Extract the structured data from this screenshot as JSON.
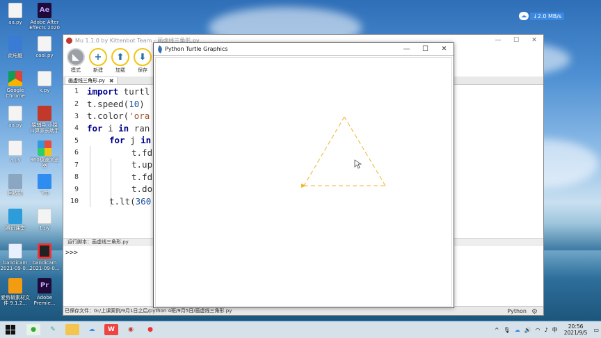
{
  "netspeed": {
    "value": "↓2.0 MB/s"
  },
  "desktop": {
    "icons": [
      {
        "label": "aa.py",
        "icon": "python-file-icon"
      },
      {
        "label": "Adobe After Effects 2020",
        "icon": "after-effects-icon"
      },
      {
        "label": "此电脑",
        "icon": "this-pc-icon"
      },
      {
        "label": "cool.py",
        "icon": "python-file-icon"
      },
      {
        "label": "Google Chrome",
        "icon": "chrome-icon"
      },
      {
        "label": "k.py",
        "icon": "python-file-icon"
      },
      {
        "label": "aa.py",
        "icon": "python-file-icon"
      },
      {
        "label": "猿辅导 小猿口算家长助手",
        "icon": "app-icon"
      },
      {
        "label": "a.py",
        "icon": "python-file-icon"
      },
      {
        "label": "360极速浏览器",
        "icon": "360-browser-icon"
      },
      {
        "label": "回收站",
        "icon": "recycle-bin-icon"
      },
      {
        "label": "飞书",
        "icon": "feishu-icon"
      },
      {
        "label": "腾讯课堂",
        "icon": "tencent-class-icon"
      },
      {
        "label": "1.py",
        "icon": "python-file-icon"
      },
      {
        "label": "bandicam 2021-09-0...",
        "icon": "document-icon"
      },
      {
        "label": "bandicam 2021-09-0...",
        "icon": "bandicam-icon"
      },
      {
        "label": "爱剪辑素材文件 9.1.2...",
        "icon": "editor-icon"
      },
      {
        "label": "Adobe Premie...",
        "icon": "premiere-icon"
      }
    ]
  },
  "mu": {
    "title": "Mu 1.1.0 by Kittenbot Team - 画虚线三角形.py",
    "controls": {
      "minimize": "—",
      "maximize": "☐",
      "close": "✕"
    },
    "toolbar": {
      "mode": "模式",
      "new": "新建",
      "load": "加载",
      "save": "保存"
    },
    "tab": {
      "label": "画虚线三角形.py",
      "close": "✖"
    },
    "line_numbers": [
      "1",
      "2",
      "3",
      "4",
      "5",
      "6",
      "7",
      "8",
      "9",
      "10"
    ],
    "code": {
      "l1_kw": "import",
      "l1_rest": " turtl",
      "l2_a": "t.speed(",
      "l2_num": "10",
      "l2_b": ")",
      "l3_a": "t.color(",
      "l3_str": "'ora",
      "l4_kw1": "for",
      "l4_mid": " i ",
      "l4_kw2": "in",
      "l4_rest": " ran",
      "l5_kw1": "for",
      "l5_mid": " j ",
      "l5_kw2": "in",
      "l6": "t.fd",
      "l7": "t.up",
      "l8": "t.fd",
      "l9": "t.do",
      "l10_a": "t.lt(",
      "l10_num": "360"
    },
    "run_bar": "运行脚本：画虚线三角形.py",
    "repl_prompt": ">>>",
    "status": "已保存文件：G:/上课案例/9月1日之后/python 4班/9月5日/画虚线三角形.py",
    "mode_label": "Python"
  },
  "turtle": {
    "title": "Python Turtle Graphics",
    "controls": {
      "minimize": "—",
      "maximize": "☐",
      "close": "✕"
    },
    "pen_color": "#f0b429"
  },
  "taskbar": {
    "tray": {
      "caret": "^",
      "ime": "中",
      "time": "20:56",
      "date": "2021/9/5"
    }
  }
}
